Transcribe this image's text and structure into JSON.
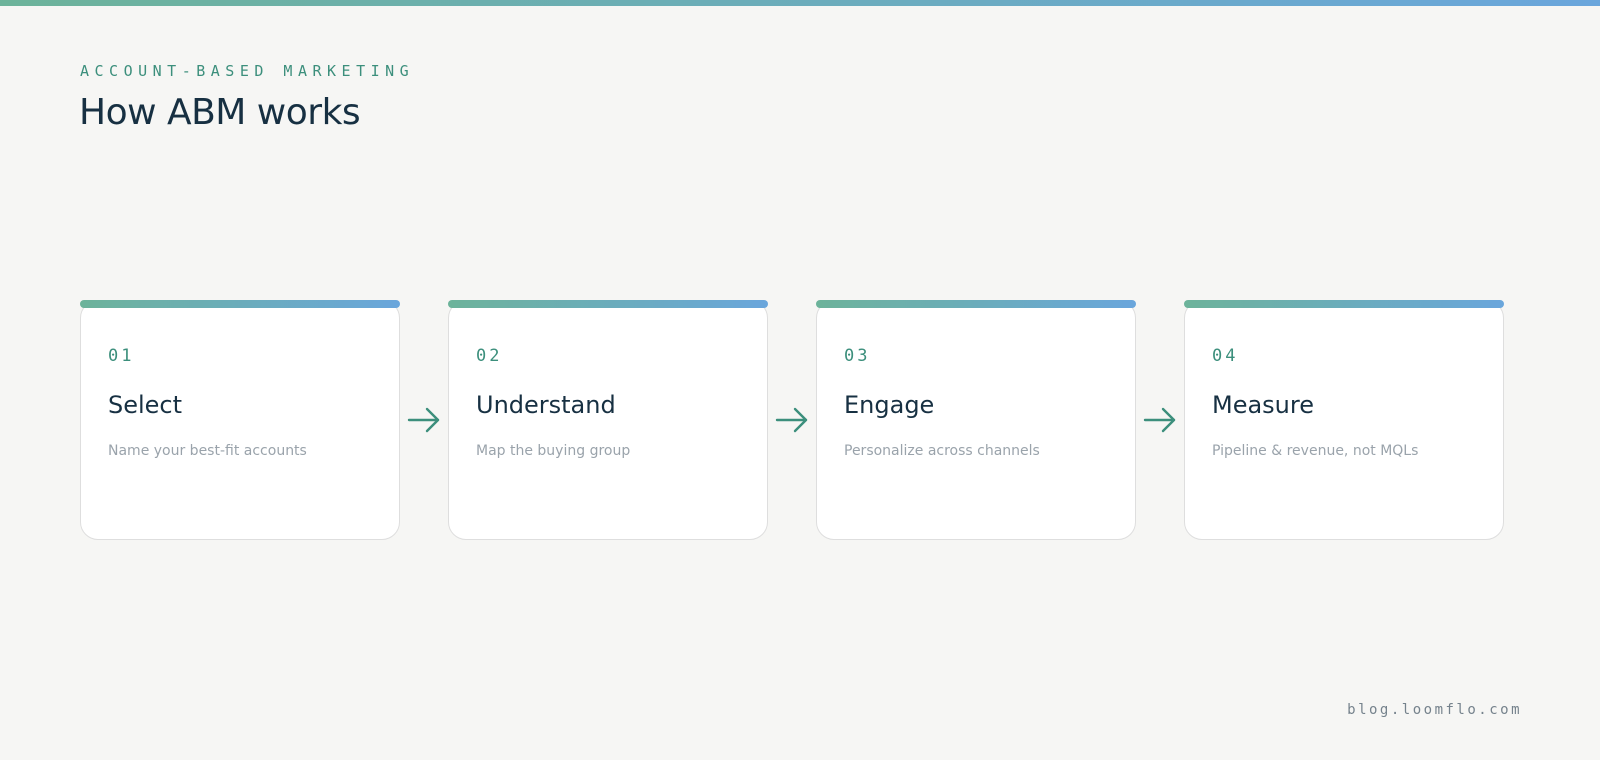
{
  "header": {
    "eyebrow": "ACCOUNT-BASED MARKETING",
    "title": "How ABM works"
  },
  "colors": {
    "accent_start": "#6cb39a",
    "accent_end": "#6aa6dc",
    "teal": "#3c8f7c",
    "navy": "#173042"
  },
  "steps": [
    {
      "number": "01",
      "title": "Select",
      "description": "Name your best-fit accounts"
    },
    {
      "number": "02",
      "title": "Understand",
      "description": "Map the buying group"
    },
    {
      "number": "03",
      "title": "Engage",
      "description": "Personalize across channels"
    },
    {
      "number": "04",
      "title": "Measure",
      "description": "Pipeline & revenue, not MQLs"
    }
  ],
  "connector_icon": "arrow-right-icon",
  "footer": {
    "site": "blog.loomflo.com"
  }
}
